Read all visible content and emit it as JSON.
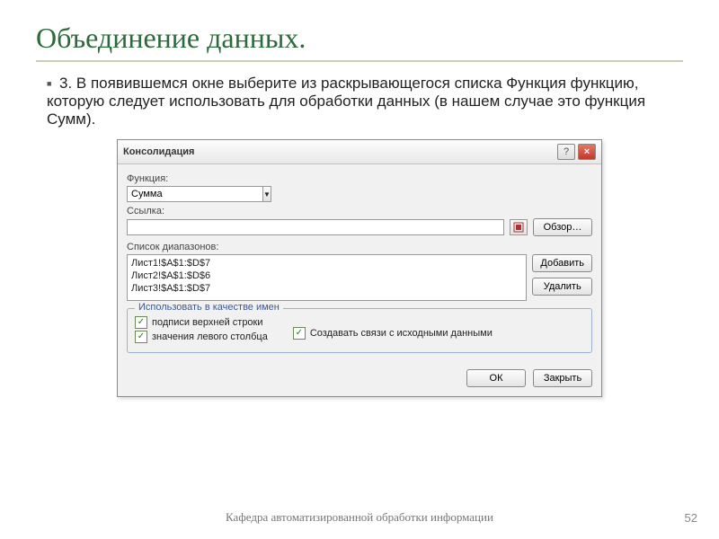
{
  "slide": {
    "title": "Объединение данных.",
    "bullet": "3. В появившемся окне выберите из раскрывающегося списка Функция функцию, которую следует использовать для обработки данных (в нашем случае это функция Сумм).",
    "footer": "Кафедра автоматизированной обработки информации",
    "page": "52"
  },
  "dialog": {
    "title": "Консолидация",
    "help_glyph": "?",
    "close_glyph": "×",
    "function_label": "Функция:",
    "function_value": "Сумма",
    "reference_label": "Ссылка:",
    "reference_value": "",
    "browse_label": "Обзор…",
    "ranges_label": "Список диапазонов:",
    "ranges": [
      "Лист1!$A$1:$D$7",
      "Лист2!$A$1:$D$6",
      "Лист3!$A$1:$D$7"
    ],
    "add_label": "Добавить",
    "delete_label": "Удалить",
    "groupbox_legend": "Использовать в качестве имен",
    "chk_top_row": "подписи верхней строки",
    "chk_left_col": "значения левого столбца",
    "chk_create_links": "Создавать связи с исходными данными",
    "ok_label": "ОК",
    "close_label": "Закрыть"
  }
}
